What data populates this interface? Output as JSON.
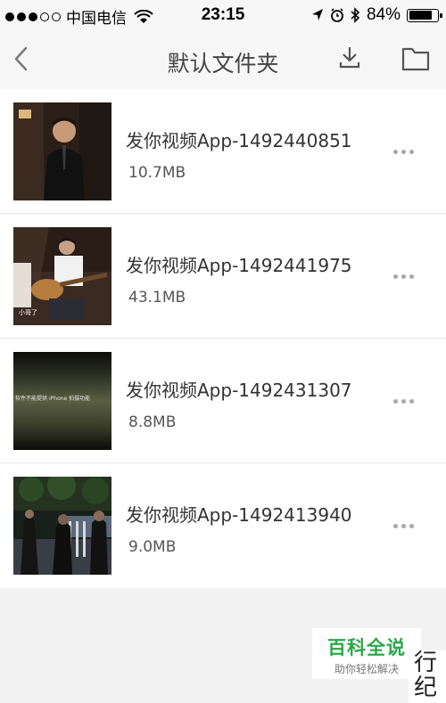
{
  "status_bar": {
    "signal_dots_filled": 3,
    "signal_dots_total": 5,
    "carrier": "中国电信",
    "time": "23:15",
    "battery_percent": "84%",
    "battery_level": 0.84,
    "icons": [
      "wifi-icon",
      "location-icon",
      "alarm-icon",
      "bluetooth-icon",
      "battery-icon"
    ]
  },
  "nav": {
    "title": "默认文件夹",
    "icons": [
      "back-icon",
      "download-icon",
      "folder-icon"
    ]
  },
  "files": [
    {
      "name": "发你视频App-1492440851",
      "size": "10.7MB"
    },
    {
      "name": "发你视频App-1492441975",
      "size": "43.1MB"
    },
    {
      "name": "发你视频App-1492431307",
      "size": "8.8MB"
    },
    {
      "name": "发你视频App-1492413940",
      "size": "9.0MB"
    }
  ],
  "thumbnail_captions": {
    "guitar": "小哥了",
    "dark_scene_line1": "软件不能提供",
    "dark_scene_line2": "iPhone 拍摄功能"
  },
  "watermark": {
    "title": "百科全说",
    "subtitle": "助你轻松解决",
    "color": "#2aa84a"
  },
  "corner_text": "行 纪"
}
